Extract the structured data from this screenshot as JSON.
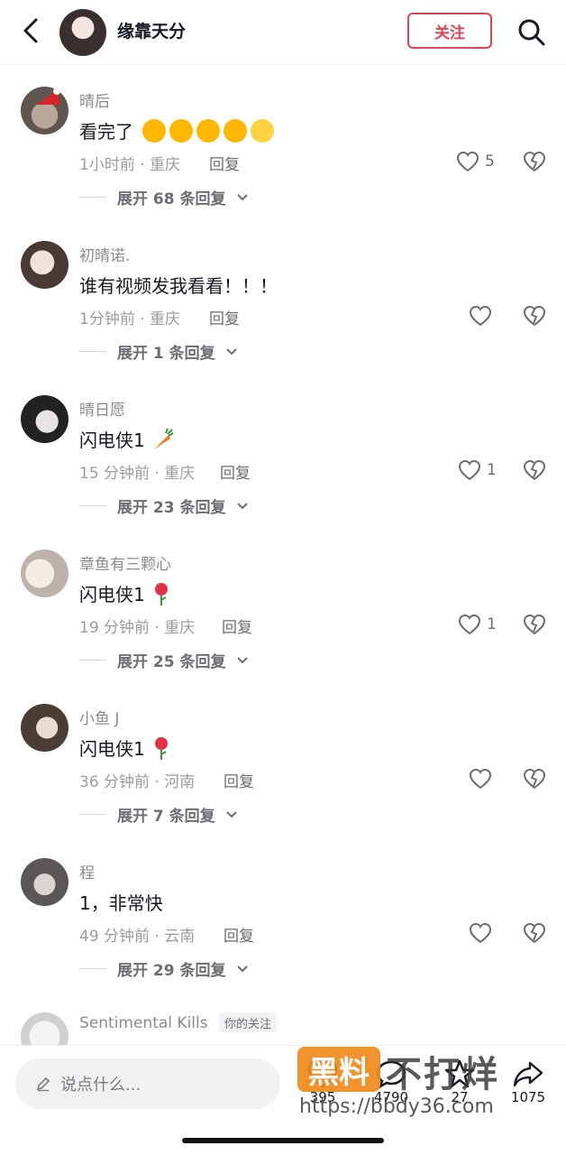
{
  "header": {
    "username": "缘靠天分",
    "follow_label": "关注"
  },
  "comments": [
    {
      "user": "晴后",
      "text": "看完了",
      "time_loc": "1小时前 · 重庆",
      "reply": "回复",
      "likes": "5",
      "expand": "展开 68 条回复"
    },
    {
      "user": "初晴诺.",
      "text": "谁有视频发我看看！！！",
      "time_loc": "1分钟前 · 重庆",
      "reply": "回复",
      "likes": "",
      "expand": "展开 1 条回复"
    },
    {
      "user": "晴日愿",
      "text": "闪电侠1",
      "time_loc": "15 分钟前 · 重庆",
      "reply": "回复",
      "likes": "1",
      "expand": "展开 23 条回复"
    },
    {
      "user": "章鱼有三颗心",
      "text": "闪电侠1",
      "time_loc": "19 分钟前 · 重庆",
      "reply": "回复",
      "likes": "1",
      "expand": "展开 25 条回复"
    },
    {
      "user": "小鱼 J",
      "text": "闪电侠1",
      "time_loc": "36 分钟前 · 河南",
      "reply": "回复",
      "likes": "",
      "expand": "展开 7 条回复"
    },
    {
      "user": "程",
      "text": "1，非常快",
      "time_loc": "49 分钟前 · 云南",
      "reply": "回复",
      "likes": "",
      "expand": "展开 29 条回复"
    },
    {
      "user": "Sentimental Kills",
      "badge": "你的关注"
    }
  ],
  "bottom": {
    "input_placeholder": "说点什么...",
    "counts": [
      "395",
      "4790",
      "27",
      "1075"
    ]
  },
  "watermark": {
    "box_text": "黑料",
    "big_text": "不打烊",
    "url": "https://bbdy36.com"
  },
  "colors": {
    "accent": "#e0425a",
    "text": "#161823",
    "muted": "#9a9ba1"
  }
}
